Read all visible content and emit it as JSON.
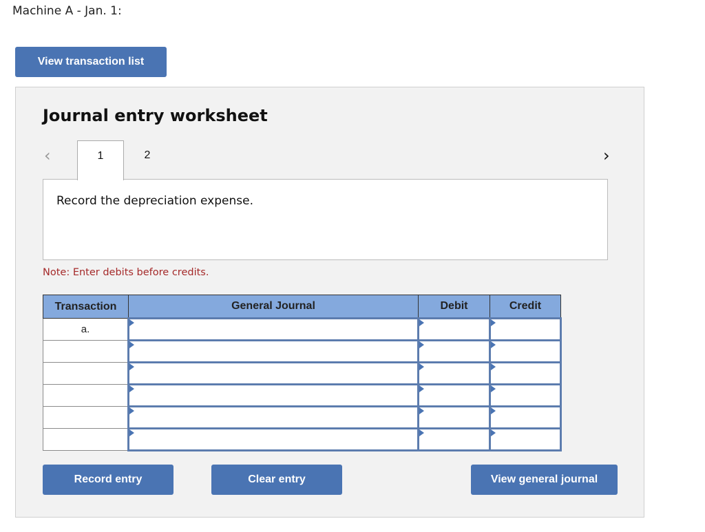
{
  "header": {
    "title": "Machine A - Jan. 1:",
    "view_transaction_list": "View transaction list"
  },
  "worksheet": {
    "title": "Journal entry worksheet",
    "nav_prev_icon": "‹",
    "nav_next_icon": "›",
    "tabs": [
      {
        "label": "1",
        "active": true
      },
      {
        "label": "2",
        "active": false
      }
    ],
    "description": "Record the depreciation expense.",
    "note": "Note: Enter debits before credits."
  },
  "table": {
    "columns": [
      "Transaction",
      "General Journal",
      "Debit",
      "Credit"
    ],
    "rows": [
      {
        "transaction": "a.",
        "account": "",
        "debit": "",
        "credit": ""
      },
      {
        "transaction": "",
        "account": "",
        "debit": "",
        "credit": ""
      },
      {
        "transaction": "",
        "account": "",
        "debit": "",
        "credit": ""
      },
      {
        "transaction": "",
        "account": "",
        "debit": "",
        "credit": ""
      },
      {
        "transaction": "",
        "account": "",
        "debit": "",
        "credit": ""
      },
      {
        "transaction": "",
        "account": "",
        "debit": "",
        "credit": ""
      }
    ]
  },
  "actions": {
    "record_entry": "Record entry",
    "clear_entry": "Clear entry",
    "view_general_journal": "View general journal"
  },
  "colors": {
    "button": "#4a74b3",
    "header_bg": "#84a9dd",
    "note": "#a52a2a"
  }
}
